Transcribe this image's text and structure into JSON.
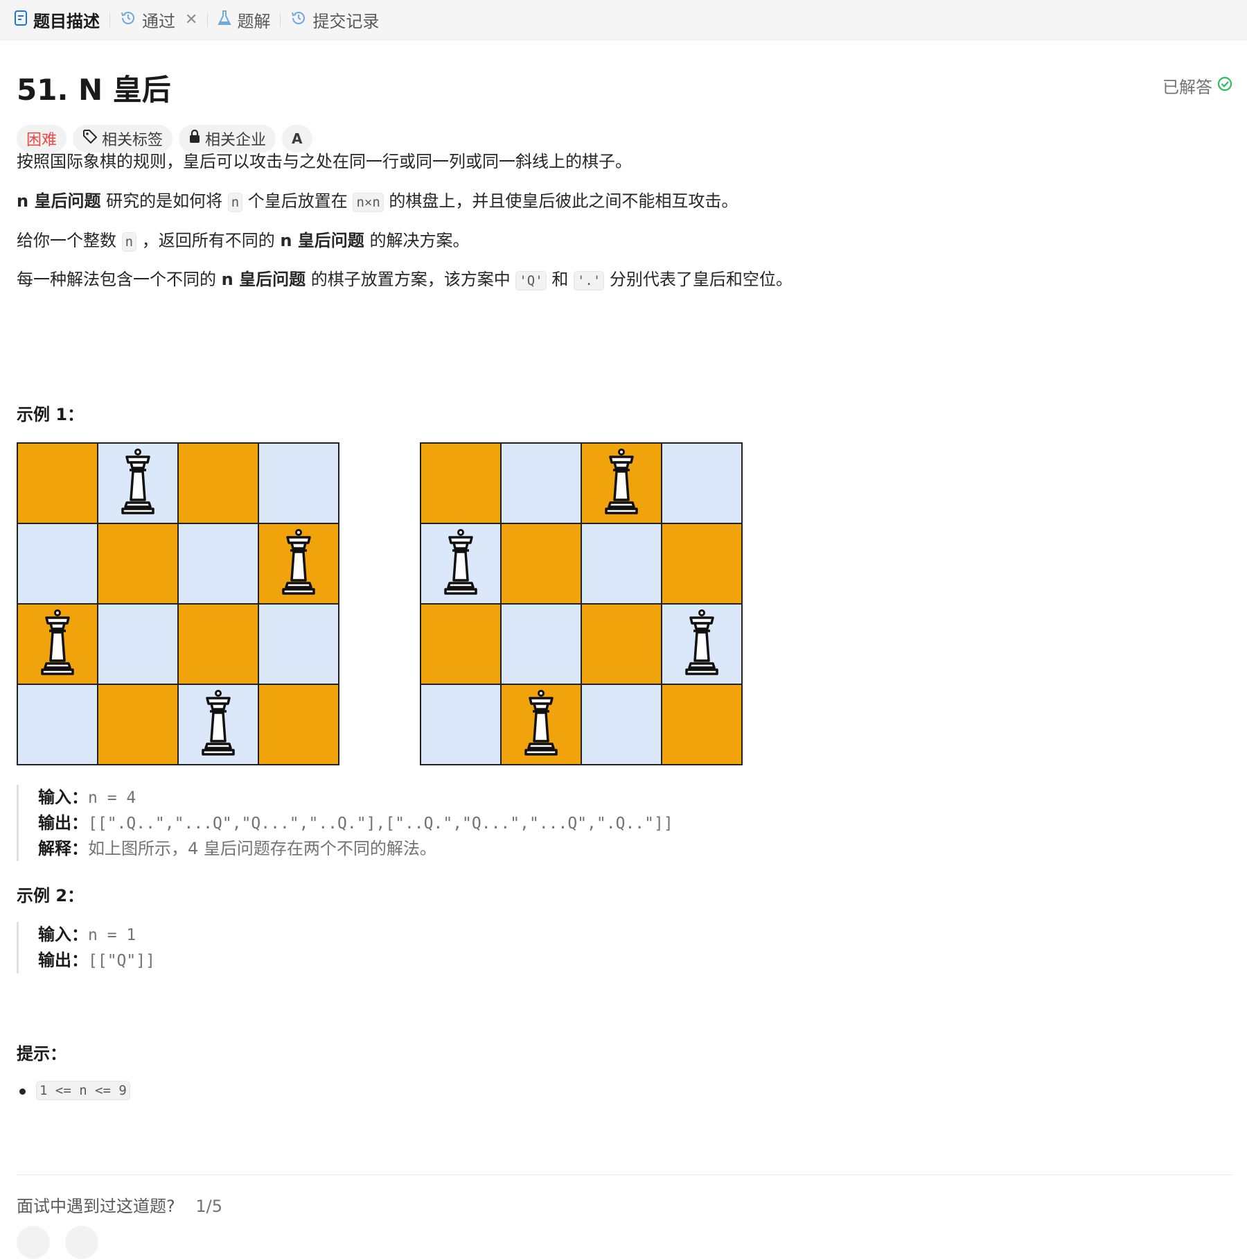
{
  "tabs": [
    {
      "label": "题目描述",
      "icon": "document-icon"
    },
    {
      "label": "通过",
      "icon": "history-icon"
    },
    {
      "label": "题解",
      "icon": "flask-icon"
    },
    {
      "label": "提交记录",
      "icon": "history-icon"
    }
  ],
  "problem": {
    "title": "51. N 皇后",
    "status": "已解答",
    "difficulty": "困难",
    "tags": [
      "相关标签",
      "相关企业"
    ]
  },
  "description": {
    "p1": "按照国际象棋的规则，皇后可以攻击与之处在同一行或同一列或同一斜线上的棋子。",
    "p2_bold": "n 皇后问题",
    "p2_a": " 研究的是如何将 ",
    "p2_code1": "n",
    "p2_b": " 个皇后放置在 ",
    "p2_code2": "n×n",
    "p2_c": " 的棋盘上，并且使皇后彼此之间不能相互攻击。",
    "p3_a": "给你一个整数 ",
    "p3_code": "n",
    "p3_b": " ，返回所有不同的 ",
    "p3_bold": "n 皇后问题",
    "p3_c": " 的解决方案。",
    "p4_a": "每一种解法包含一个不同的 ",
    "p4_bold": "n 皇后问题",
    "p4_b": " 的棋子放置方案，该方案中 ",
    "p4_code1": "'Q'",
    "p4_c": " 和 ",
    "p4_code2": "'.'",
    "p4_d": " 分别代表了皇后和空位。"
  },
  "example1": {
    "heading": "示例 1：",
    "boards": [
      {
        "queens": [
          1,
          3,
          0,
          2
        ]
      },
      {
        "queens": [
          2,
          0,
          3,
          1
        ]
      }
    ],
    "input_label": "输入：",
    "input": "n = 4",
    "output_label": "输出：",
    "output": "[[\".Q..\",\"...Q\",\"Q...\",\"..Q.\"],[\"..Q.\",\"Q...\",\"...Q\",\".Q..\"]]",
    "explain_label": "解释：",
    "explain": "如上图所示，4 皇后问题存在两个不同的解法。"
  },
  "example2": {
    "heading": "示例 2：",
    "input_label": "输入：",
    "input": "n = 1",
    "output_label": "输出：",
    "output": "[[\"Q\"]]"
  },
  "hints": {
    "heading": "提示：",
    "items": [
      "1 <= n <= 9"
    ]
  },
  "footer": {
    "question": "面试中遇到过这道题?",
    "count": "1/5"
  },
  "colors": {
    "orange": "#f0a30a",
    "light_blue": "#dbe8f9",
    "hard": "#ef4743",
    "solved_green": "#2cbb5d"
  }
}
